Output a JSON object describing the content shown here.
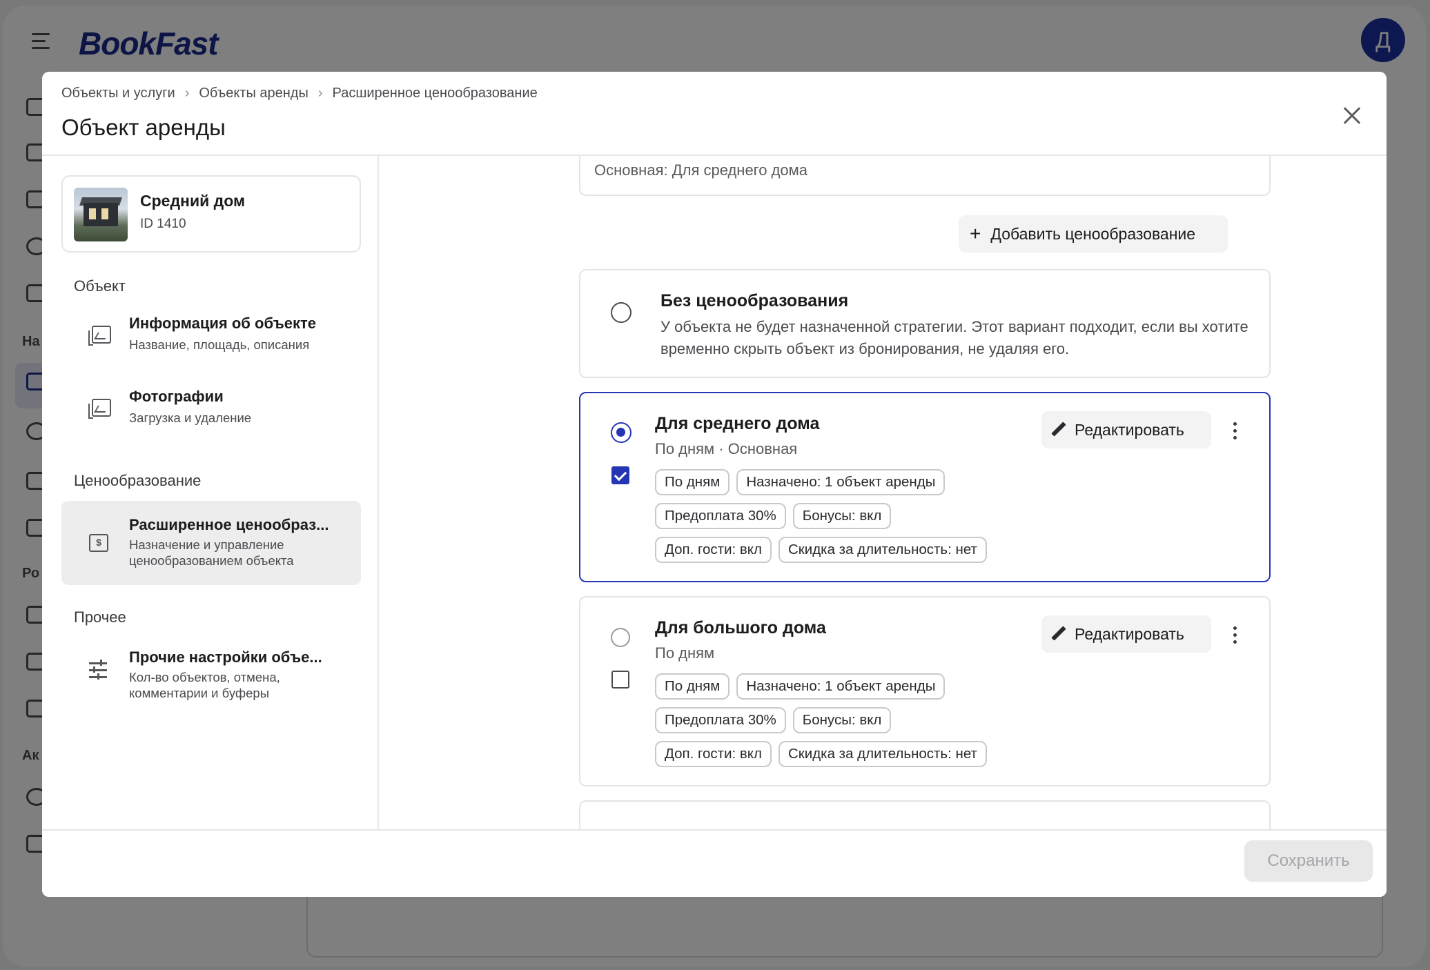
{
  "app": {
    "logo": "BookFast",
    "avatar_letter": "Д",
    "sidebar_sections": [
      "На",
      "Ро",
      "Ак"
    ]
  },
  "modal": {
    "breadcrumb": [
      "Объекты и услуги",
      "Объекты аренды",
      "Расширенное ценообразование"
    ],
    "title": "Объект аренды",
    "object": {
      "name": "Средний дом",
      "id": "ID 1410"
    },
    "sections": {
      "object": "Объект",
      "pricing": "Ценообразование",
      "other": "Прочее"
    },
    "nav": {
      "info": {
        "title": "Информация об объекте",
        "sub": "Название, площадь, описания"
      },
      "photos": {
        "title": "Фотографии",
        "sub": "Загрузка и удаление"
      },
      "advanced_pricing": {
        "title": "Расширенное ценообраз...",
        "sub": "Назначение и управление ценообразованием объекта"
      },
      "other_settings": {
        "title": "Прочие настройки объе...",
        "sub": "Кол-во объектов, отмена, комментарии и буферы"
      }
    },
    "main_pricing_value": "Основная: Для среднего дома",
    "add_pricing_label": "Добавить ценообразование",
    "no_pricing": {
      "title": "Без ценообразования",
      "description": "У объекта не будет назначенной стратегии. Этот вариант подходит, если вы хотите временно скрыть объект из бронирования, не удаляя его."
    },
    "cards": [
      {
        "title": "Для среднего дома",
        "subtitle": "По дням · Основная",
        "edit_label": "Редактировать",
        "tags_row1": [
          "По дням",
          "Назначено: 1 объект аренды"
        ],
        "tags_row2": [
          "Предоплата 30%",
          "Бонусы: вкл"
        ],
        "tags_row3": [
          "Доп. гости: вкл",
          "Скидка за длительность: нет"
        ]
      },
      {
        "title": "Для большого дома",
        "subtitle": "По дням",
        "edit_label": "Редактировать",
        "tags_row1": [
          "По дням",
          "Назначено: 1 объект аренды"
        ],
        "tags_row2": [
          "Предоплата 30%",
          "Бонусы: вкл"
        ],
        "tags_row3": [
          "Доп. гости: вкл",
          "Скидка за длительность: нет"
        ]
      }
    ],
    "save_label": "Сохранить"
  },
  "colors": {
    "accent": "#2436b4",
    "logo": "#1a2a8f",
    "overlay": "rgba(0,0,0,0.5)"
  }
}
